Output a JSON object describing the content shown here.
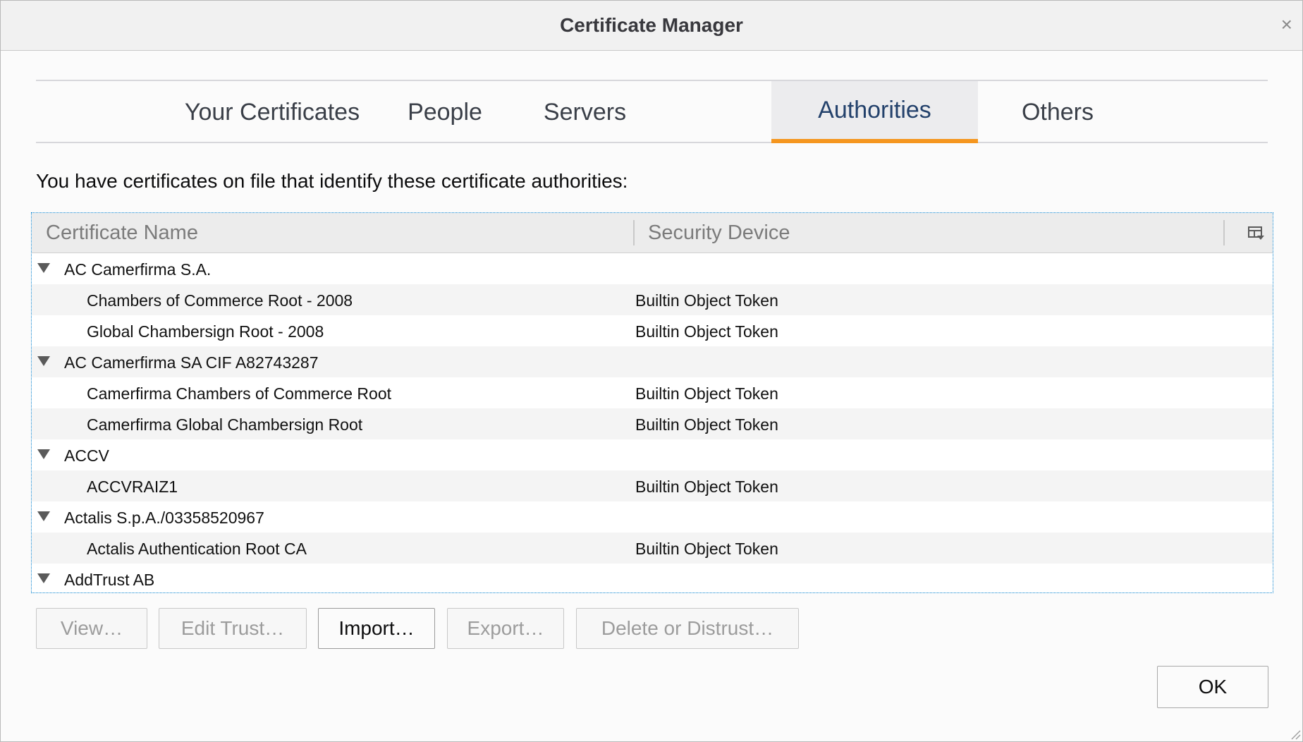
{
  "window": {
    "title": "Certificate Manager",
    "close_glyph": "×"
  },
  "tabs": [
    {
      "label": "Your Certificates",
      "selected": false
    },
    {
      "label": "People",
      "selected": false
    },
    {
      "label": "Servers",
      "selected": false
    },
    {
      "label": "Authorities",
      "selected": true
    },
    {
      "label": "Others",
      "selected": false
    }
  ],
  "description": "You have certificates on file that identify these certificate authorities:",
  "tree": {
    "columns": [
      "Certificate Name",
      "Security Device"
    ],
    "column_picker_icon": "column-picker-icon",
    "rows": [
      {
        "type": "group",
        "name": "AC Camerfirma S.A.",
        "device": ""
      },
      {
        "type": "child",
        "name": "Chambers of Commerce Root - 2008",
        "device": "Builtin Object Token"
      },
      {
        "type": "child",
        "name": "Global Chambersign Root - 2008",
        "device": "Builtin Object Token"
      },
      {
        "type": "group",
        "name": "AC Camerfirma SA CIF A82743287",
        "device": ""
      },
      {
        "type": "child",
        "name": "Camerfirma Chambers of Commerce Root",
        "device": "Builtin Object Token"
      },
      {
        "type": "child",
        "name": "Camerfirma Global Chambersign Root",
        "device": "Builtin Object Token"
      },
      {
        "type": "group",
        "name": "ACCV",
        "device": ""
      },
      {
        "type": "child",
        "name": "ACCVRAIZ1",
        "device": "Builtin Object Token"
      },
      {
        "type": "group",
        "name": "Actalis S.p.A./03358520967",
        "device": ""
      },
      {
        "type": "child",
        "name": "Actalis Authentication Root CA",
        "device": "Builtin Object Token"
      },
      {
        "type": "group",
        "name": "AddTrust AB",
        "device": ""
      }
    ]
  },
  "actions": {
    "view": "View…",
    "edit_trust": "Edit Trust…",
    "import": "Import…",
    "export": "Export…",
    "delete": "Delete or Distrust…"
  },
  "ok_label": "OK",
  "colors": {
    "accent_tab": "#f5961f",
    "focus_border": "#0a84d0"
  }
}
